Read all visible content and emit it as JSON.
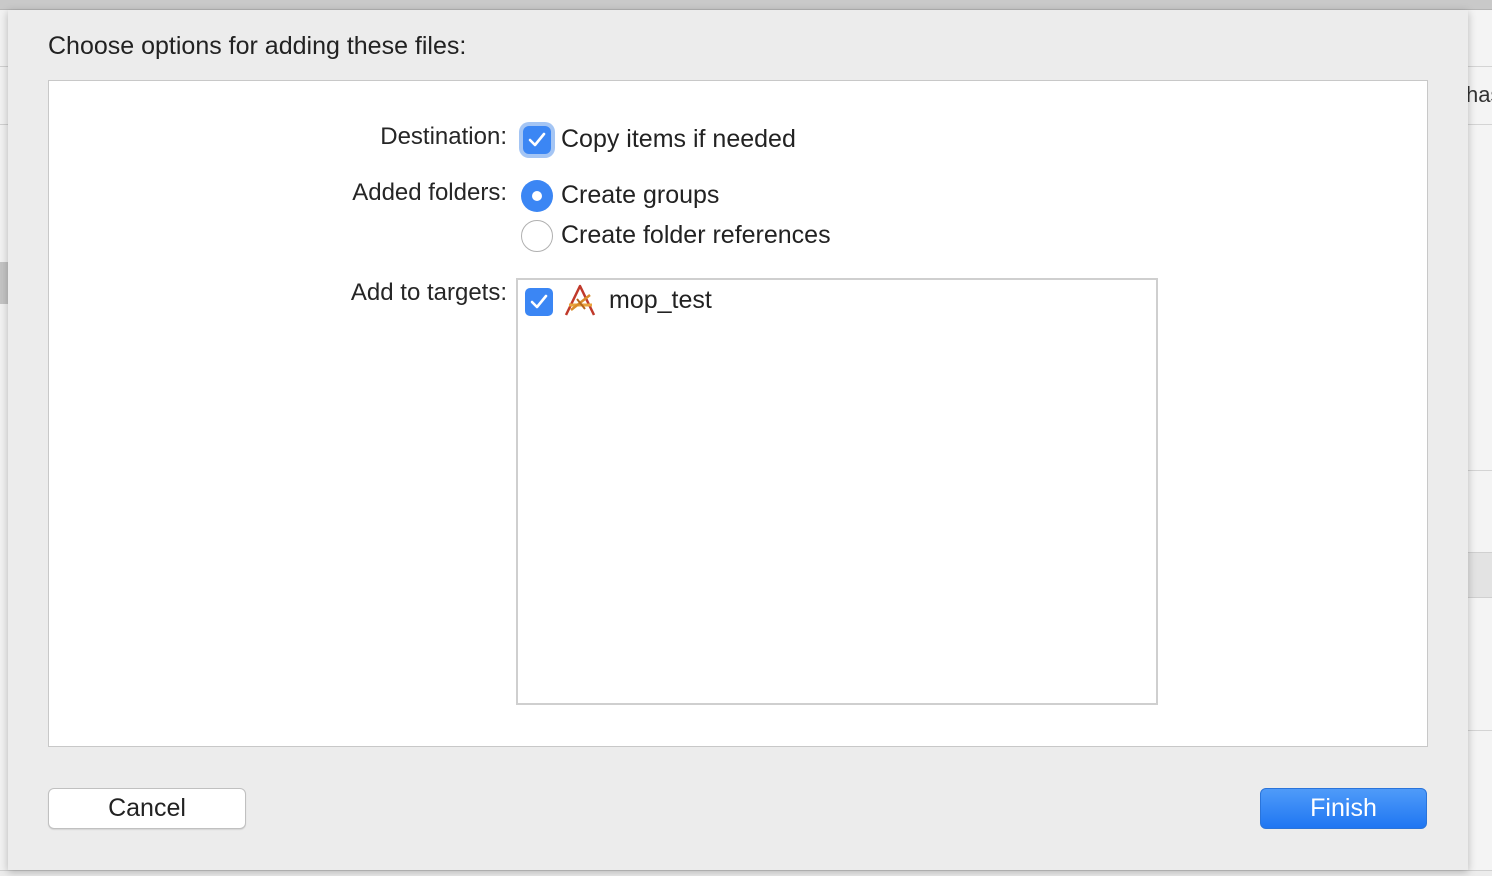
{
  "sheet": {
    "title": "Choose options for adding these files:"
  },
  "destination": {
    "label": "Destination:",
    "option_label": "Copy items if needed",
    "checked": true
  },
  "added_folders": {
    "label": "Added folders:",
    "options": [
      {
        "label": "Create groups",
        "selected": true
      },
      {
        "label": "Create folder references",
        "selected": false
      }
    ]
  },
  "targets": {
    "label": "Add to targets:",
    "items": [
      {
        "name": "mop_test",
        "checked": true,
        "icon": "app-target-icon"
      }
    ]
  },
  "buttons": {
    "cancel": "Cancel",
    "finish": "Finish"
  },
  "background": {
    "right_partial_text": "has"
  },
  "colors": {
    "accent": "#3b86f4",
    "finish_button": "#1f76f2"
  }
}
